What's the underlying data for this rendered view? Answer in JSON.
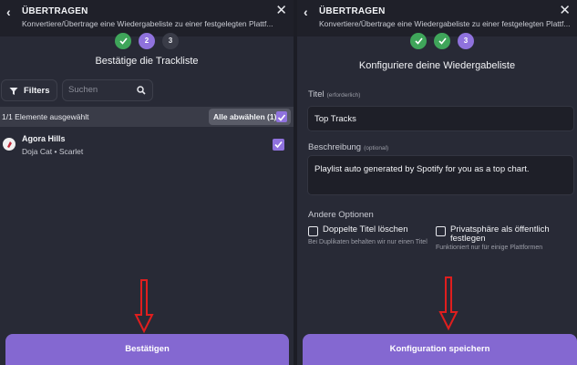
{
  "left": {
    "header_title": "ÜBERTRAGEN",
    "header_sub": "Konvertiere/Übertrage eine Wiedergabeliste zu einer festgelegten Plattf...",
    "steps": [
      "",
      "2",
      "3"
    ],
    "section_title": "Bestätige die Trackliste",
    "filters_label": "Filters",
    "search_placeholder": "Suchen",
    "selection_count": "1/1 Elemente ausgewählt",
    "unselect_all": "Alle abwählen (1)",
    "tracks": [
      {
        "name": "Agora Hills",
        "artist": "Doja Cat",
        "separator": "•",
        "album": "Scarlet"
      }
    ],
    "confirm_button": "Bestätigen"
  },
  "right": {
    "header_title": "ÜBERTRAGEN",
    "header_sub": "Konvertiere/Übertrage eine Wiedergabeliste zu einer festgelegten Plattf...",
    "steps": [
      "",
      "",
      "3"
    ],
    "section_title": "Konfiguriere deine Wiedergabeliste",
    "title_label": "Titel",
    "title_hint": "(erforderlich)",
    "title_value": "Top Tracks",
    "desc_label": "Beschreibung",
    "desc_hint": "(optional)",
    "desc_value": "Playlist auto generated by Spotify for you as a top chart.",
    "other_options": "Andere Optionen",
    "opt1_label": "Doppelte Titel löschen",
    "opt1_hint": "Bei Duplikaten behalten wir nur einen Titel",
    "opt2_label": "Privatsphäre als öffentlich festlegen",
    "opt2_hint": "Funktioniert nur für einige Plattformen",
    "save_button": "Konfiguration speichern"
  },
  "colors": {
    "accent": "#8468d1",
    "step_done": "#3fa55a",
    "step_active": "#8f72dd",
    "arrow": "#e01e1e"
  }
}
